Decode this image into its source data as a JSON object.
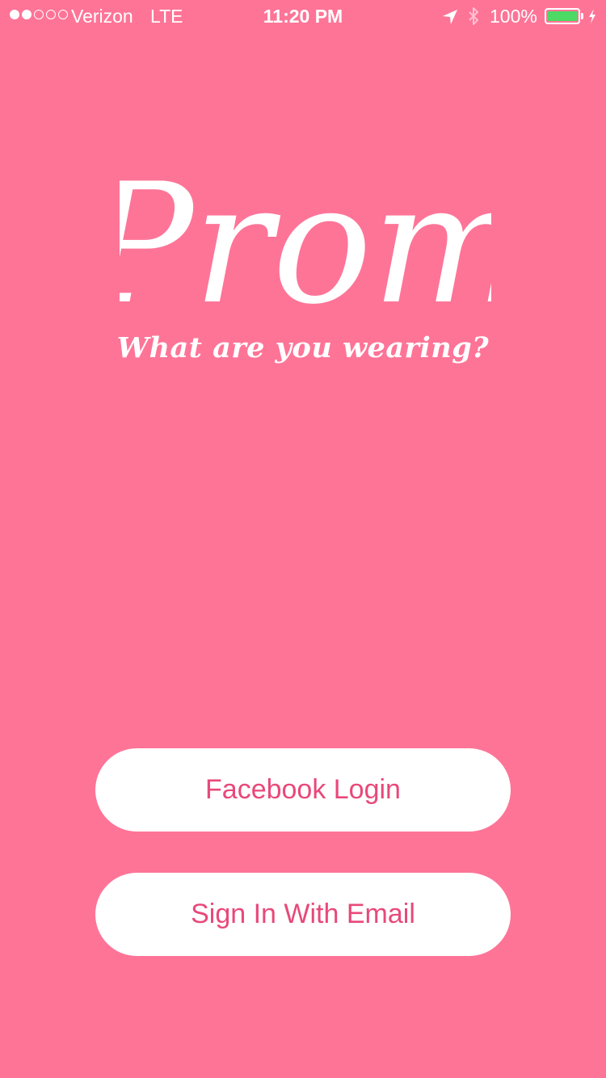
{
  "status_bar": {
    "carrier": "Verizon",
    "network": "LTE",
    "time": "11:20 PM",
    "battery_percent": "100%",
    "battery_level": 1.0,
    "battery_color": "#4CD964",
    "signal_strength": 2,
    "signal_max": 5,
    "icons": [
      "location-arrow-icon",
      "bluetooth-icon",
      "battery-icon",
      "charging-bolt-icon"
    ]
  },
  "hero": {
    "logo_text": "Prom",
    "tagline": "What are you wearing?"
  },
  "actions": {
    "facebook_login_label": "Facebook Login",
    "email_signin_label": "Sign In With Email"
  },
  "colors": {
    "background": "#FE7497",
    "button_background": "#FFFFFF",
    "button_text": "#E8497A"
  }
}
